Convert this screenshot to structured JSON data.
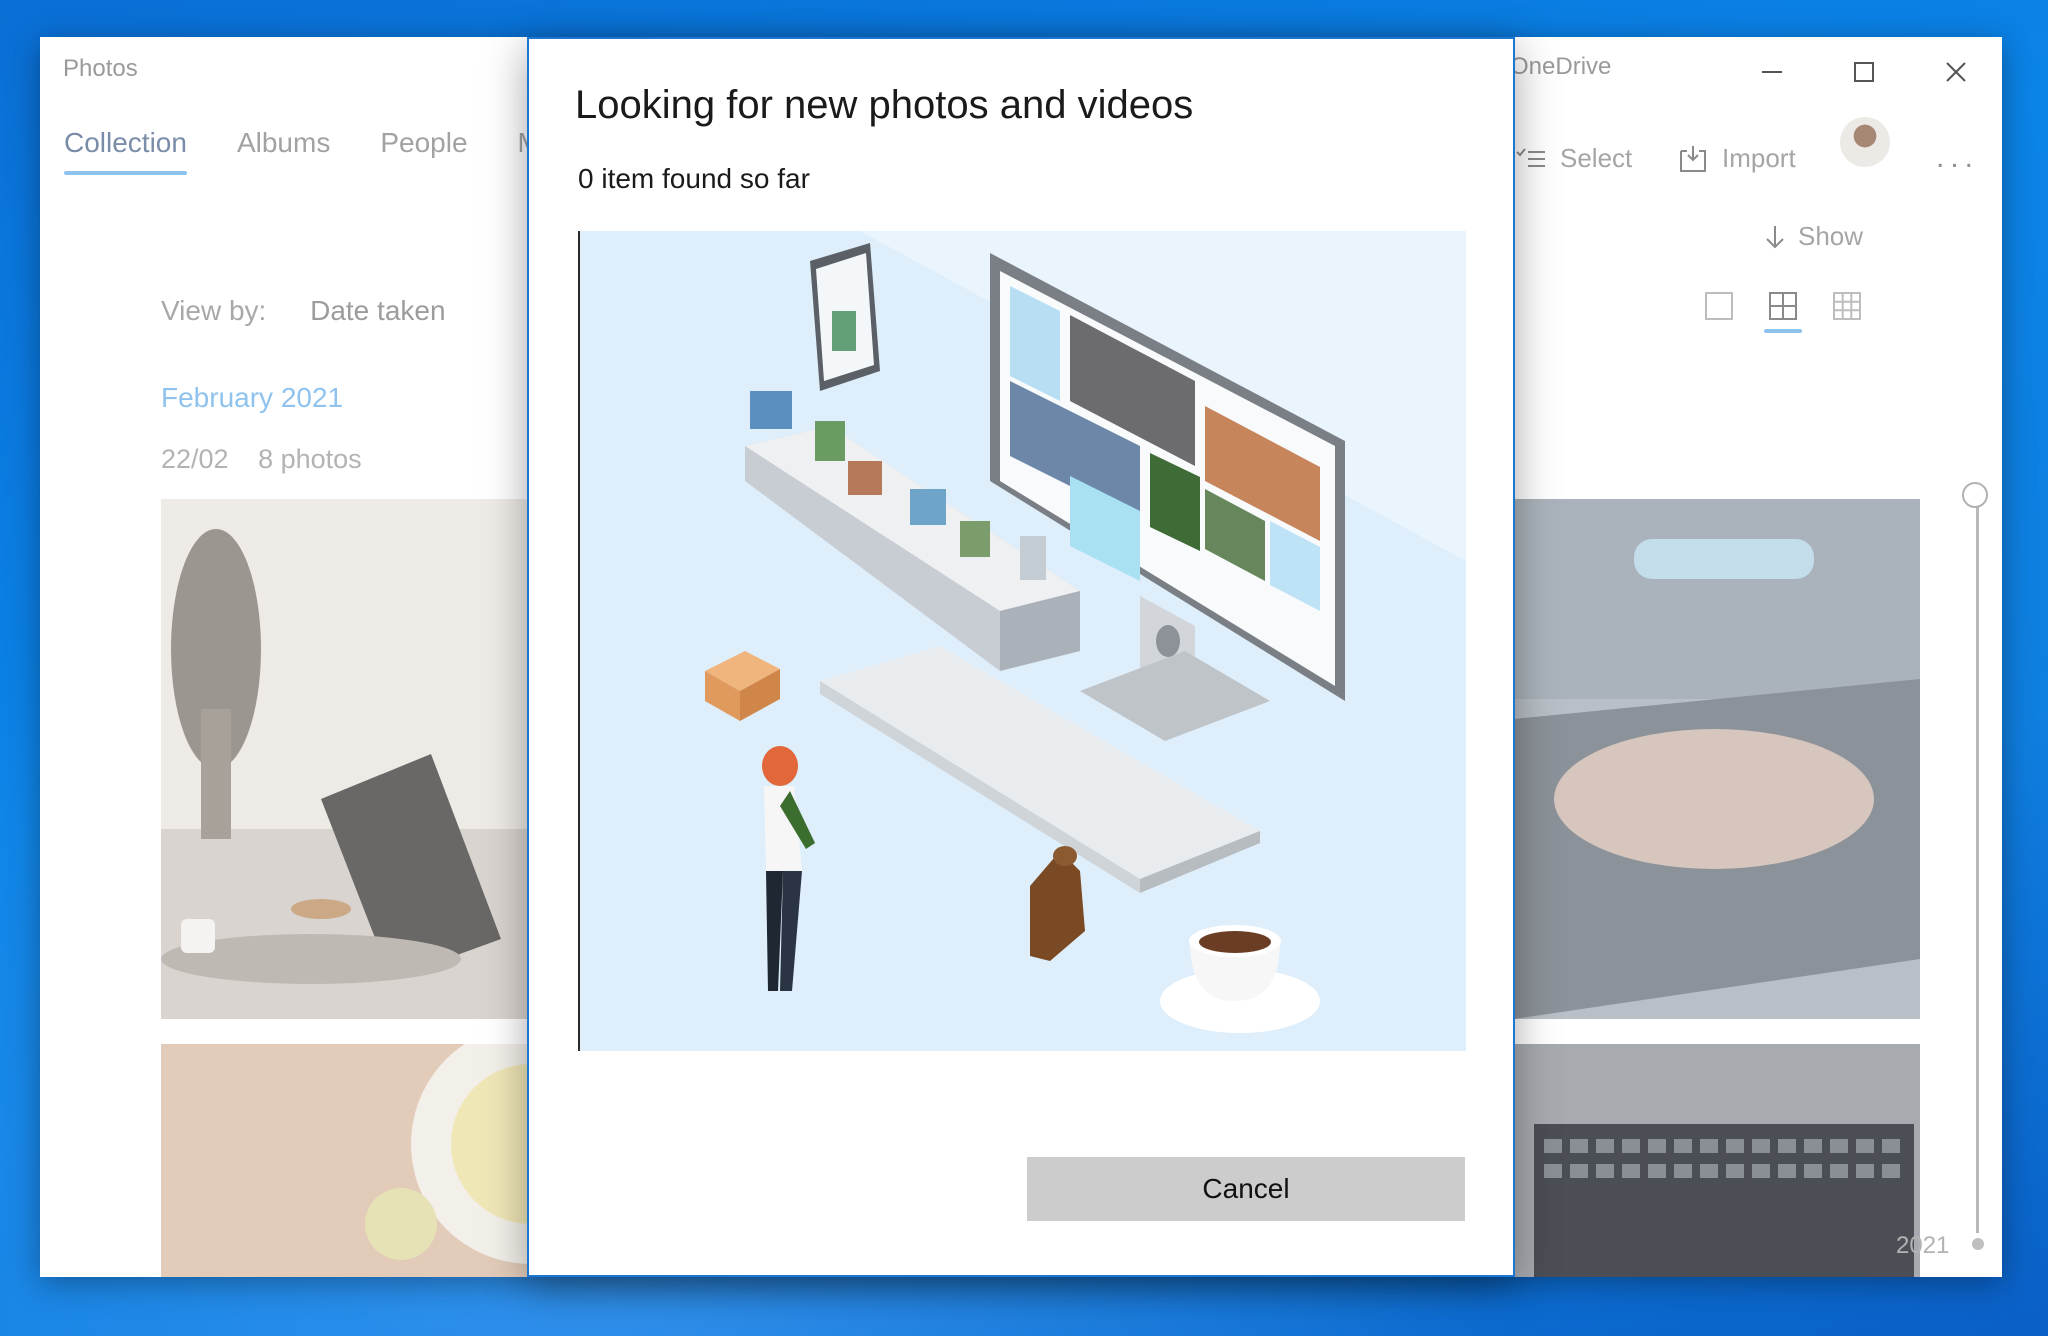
{
  "app": {
    "title": "Photos",
    "onedrive": "OneDrive",
    "nav": [
      "Collection",
      "Albums",
      "People",
      "M"
    ],
    "view_by_label": "View by:",
    "view_by_value": "Date taken",
    "month": "February 2021",
    "date": "22/02",
    "count": "8 photos",
    "select_label": "Select",
    "import_label": "Import",
    "show_label": "Show",
    "timeline_year": "2021",
    "more_label": "..."
  },
  "dialog": {
    "title": "Looking for new photos and videos",
    "subtitle": "0 item found so far",
    "cancel_label": "Cancel"
  },
  "colors": {
    "accent": "#1c76d2",
    "desktop": "#0b84e8",
    "illustration_bg": "#deeefb",
    "cancel_bg": "#cccccc"
  }
}
